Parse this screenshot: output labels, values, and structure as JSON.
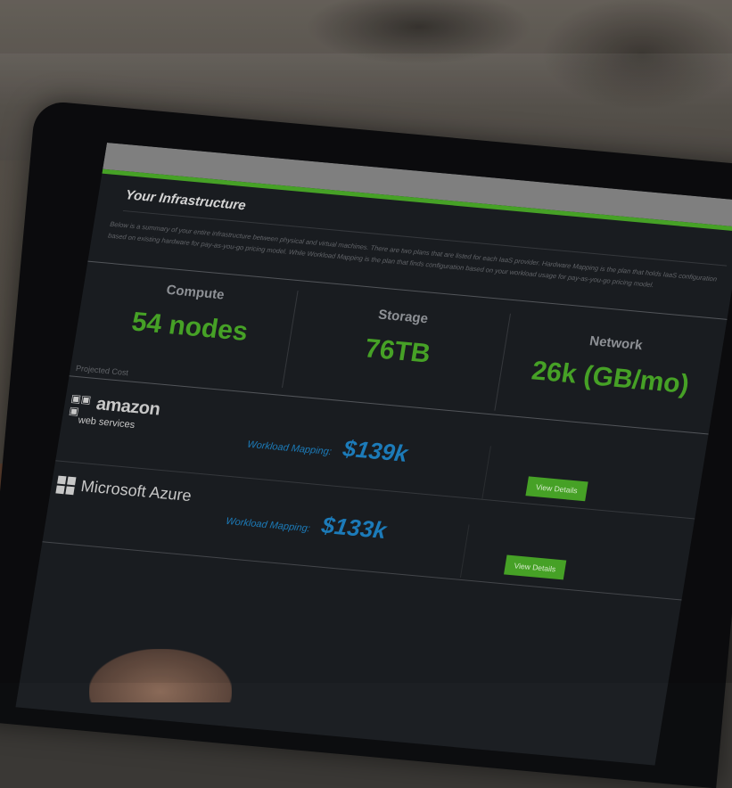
{
  "screen": {
    "title": "Your Infrastructure",
    "description": "Below is a summary of your entire infrastructure between physical and virtual machines. There are two plans that are listed for each IaaS provider. Hardware Mapping is the plan that holds IaaS configuration based on existing hardware for pay-as-you-go pricing model. While Workload Mapping is the plan that finds configuration based on your workload usage for pay-as-you-go pricing model.",
    "stats": [
      {
        "label": "Compute",
        "value": "54 nodes"
      },
      {
        "label": "Storage",
        "value": "76TB"
      },
      {
        "label": "Network",
        "value": "26k (GB/mo)"
      }
    ],
    "projected_label": "Projected Cost",
    "providers": [
      {
        "name": "amazon",
        "name_sub": "web services",
        "logo_icon": "aws-cubes-icon",
        "mapping_label": "Workload Mapping:",
        "price": "$139k",
        "button": "View Details"
      },
      {
        "name": "Microsoft Azure",
        "logo_icon": "windows-icon",
        "mapping_label": "Workload Mapping:",
        "price": "$133k",
        "button": "View Details"
      }
    ]
  },
  "colors": {
    "accent_green": "#4caf2a",
    "price_blue": "#1f86c9",
    "screen_bg": "#1c1f23"
  }
}
